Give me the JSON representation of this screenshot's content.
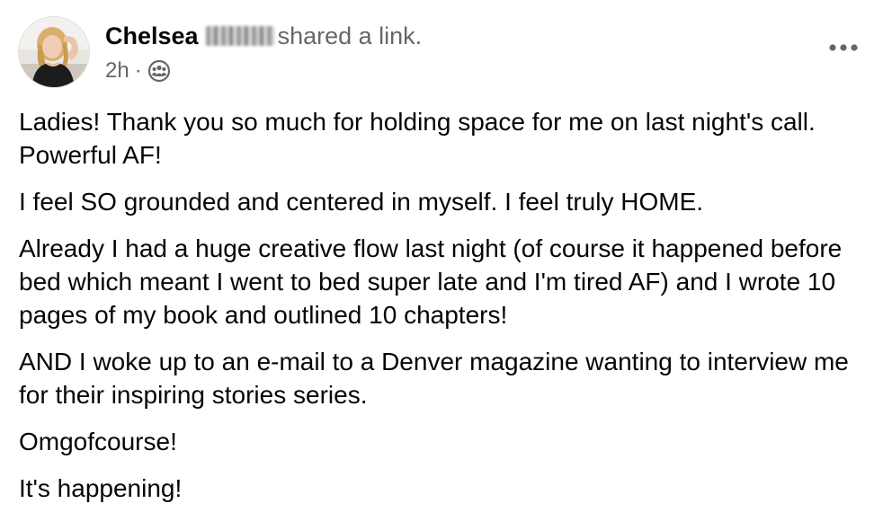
{
  "post": {
    "author_first_name": "Chelsea",
    "action_text": "shared a link.",
    "timestamp": "2h",
    "separator": "·",
    "privacy_icon": "group-audience-icon",
    "more_icon": "more-options-icon",
    "paragraphs": [
      "Ladies! Thank you so much for holding space for me on last night's call. Powerful AF!",
      "I feel SO grounded and centered in myself. I feel truly HOME.",
      "Already I had a huge creative flow last night (of course it happened before bed which meant I went to bed super late and I'm tired AF) and I wrote 10 pages of my book and outlined 10 chapters!",
      "AND I woke up to an e-mail to a Denver magazine wanting to interview me for their inspiring stories series.",
      "Omgofcourse!",
      "It's happening!"
    ]
  },
  "colors": {
    "text_primary": "#050505",
    "text_secondary": "#65676b",
    "background": "#ffffff"
  }
}
